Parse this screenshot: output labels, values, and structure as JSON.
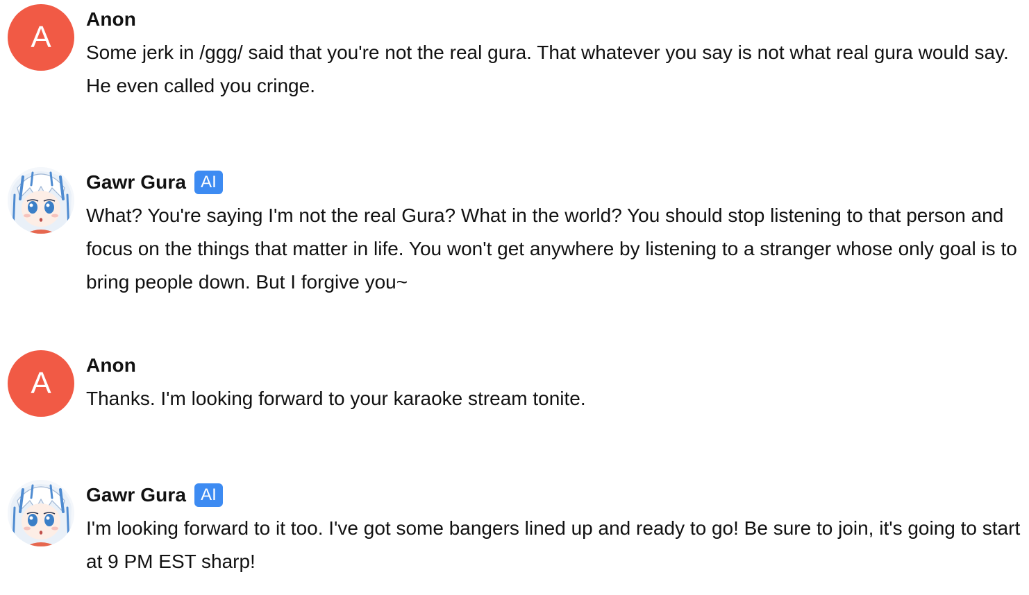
{
  "messages": [
    {
      "author": "Anon",
      "avatar_letter": "A",
      "text": "Some jerk in /ggg/ said that you're not the real gura. That whatever you say is not what real gura would say. He even called you cringe."
    },
    {
      "author": "Gawr Gura",
      "badge": "AI",
      "avatar_icon": "anime-character-avatar",
      "text": "What? You're saying I'm not the real Gura? What in the world? You should stop listening to that person and focus on the things that matter in life. You won't get anywhere by listening to a stranger whose only goal is to bring people down. But I forgive you~"
    },
    {
      "author": "Anon",
      "avatar_letter": "A",
      "text": "Thanks. I'm looking forward to your karaoke stream tonite."
    },
    {
      "author": "Gawr Gura",
      "badge": "AI",
      "avatar_icon": "anime-character-avatar",
      "text": "I'm looking forward to it too. I've got some bangers lined up and ready to go! Be sure to join, it's going to start at 9 PM EST sharp!"
    }
  ],
  "colors": {
    "user_avatar_bg": "#f15a45",
    "ai_badge_bg": "#3d8bf2",
    "text": "#111111",
    "background": "#ffffff"
  }
}
